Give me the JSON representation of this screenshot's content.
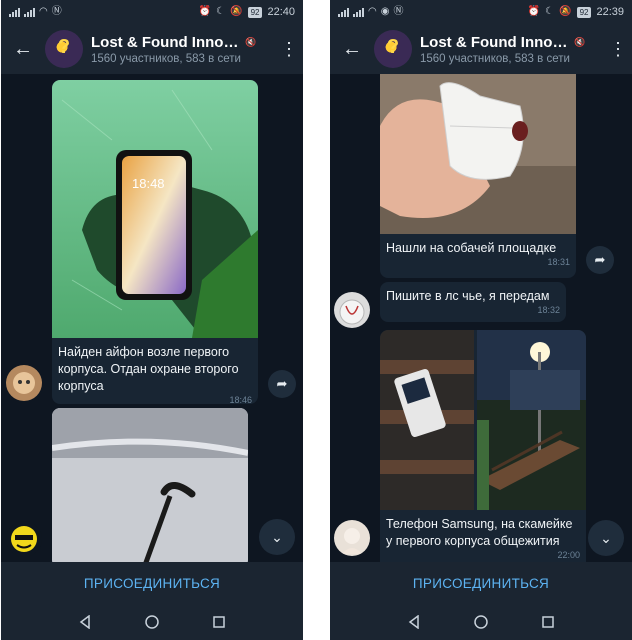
{
  "screens": [
    {
      "status": {
        "time": "22:40",
        "battery": "92"
      },
      "header": {
        "title": "Lost & Found Innop...",
        "subtitle": "1560 участников, 583 в сети"
      },
      "messages": [
        {
          "text": "Найден айфон возле первого корпуса. Отдан охране второго корпуса",
          "time": "18:46"
        }
      ],
      "join_label": "ПРИСОЕДИНИТЬСЯ"
    },
    {
      "status": {
        "time": "22:39",
        "battery": "92"
      },
      "header": {
        "title": "Lost & Found Innop...",
        "subtitle": "1560 участников, 583 в сети"
      },
      "messages": [
        {
          "text": "Нашли на собачей площадке",
          "time": "18:31"
        },
        {
          "text": "Пишите в лс чье, я передам",
          "time": "18:32"
        },
        {
          "text": "Телефон Samsung, на скамейке у первого корпуса общежития",
          "time": "22:00"
        }
      ],
      "join_label": "ПРИСОЕДИНИТЬСЯ"
    }
  ],
  "icons": {
    "back": "arrow-left-icon",
    "menu": "vertical-dots-icon",
    "share": "share-arrow-icon",
    "scroll": "chevron-down-icon",
    "nav": [
      "back-triangle-icon",
      "home-circle-icon",
      "recents-square-icon"
    ]
  },
  "colors": {
    "background": "#0e1621",
    "bar": "#1b2531",
    "bubble": "#182533",
    "accent": "#5db3f2"
  }
}
